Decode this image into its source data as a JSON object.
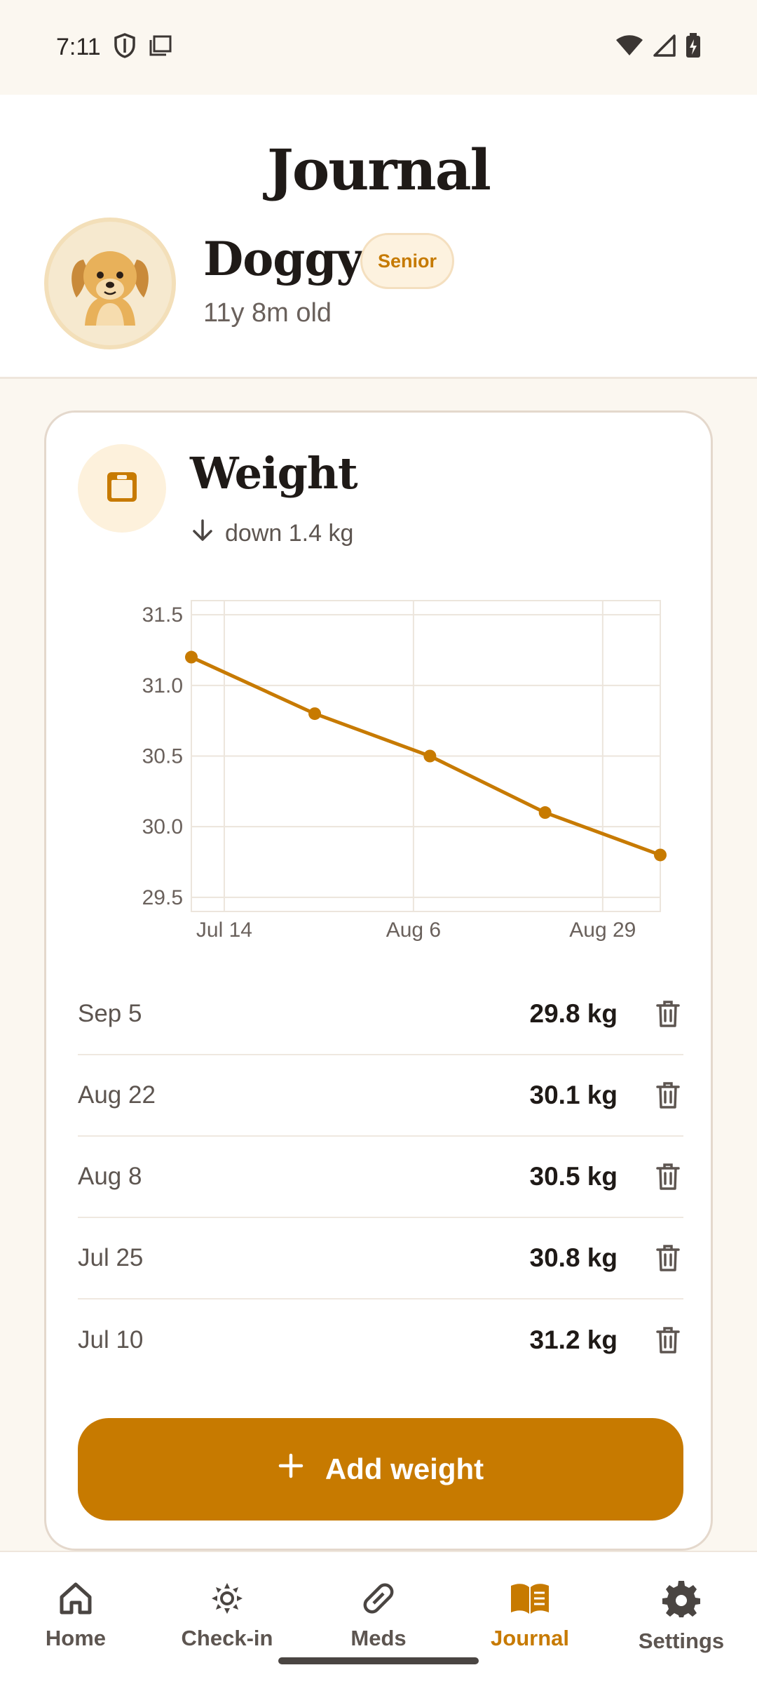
{
  "status_bar": {
    "time": "7:11",
    "icons": [
      "shield-icon",
      "screen-icon",
      "wifi-icon",
      "signal-icon",
      "battery-charging-icon"
    ]
  },
  "header": {
    "title": "Journal",
    "pet": {
      "name": "Doggy",
      "badge": "Senior",
      "age": "11y 8m old",
      "avatar_icon": "dog-avatar-icon"
    }
  },
  "weight_card": {
    "title": "Weight",
    "icon": "scale-icon",
    "trend_icon": "arrow-down-icon",
    "trend_text": "down 1.4 kg",
    "entries": [
      {
        "date": "Sep 5",
        "weight": "29.8 kg"
      },
      {
        "date": "Aug 22",
        "weight": "30.1 kg"
      },
      {
        "date": "Aug 8",
        "weight": "30.5 kg"
      },
      {
        "date": "Jul 25",
        "weight": "30.8 kg"
      },
      {
        "date": "Jul 10",
        "weight": "31.2 kg"
      }
    ],
    "add_button": {
      "label": "Add weight",
      "icon": "plus-icon"
    }
  },
  "chart_data": {
    "type": "line",
    "x": [
      "2024-07-10",
      "2024-07-25",
      "2024-08-08",
      "2024-08-22",
      "2024-09-05"
    ],
    "series": [
      {
        "values": [
          31.2,
          30.8,
          30.5,
          30.1,
          29.8
        ],
        "color": "#c77a00"
      }
    ],
    "x_ticks": [
      "Jul 14",
      "Aug 6",
      "Aug 29"
    ],
    "y_ticks": [
      "31.5",
      "31.0",
      "30.5",
      "30.0",
      "29.5"
    ],
    "ylim": [
      29.4,
      31.6
    ],
    "grid": true
  },
  "bottom_nav": {
    "items": [
      {
        "label": "Home",
        "icon": "home-icon",
        "active": false
      },
      {
        "label": "Check-in",
        "icon": "sun-icon",
        "active": false
      },
      {
        "label": "Meds",
        "icon": "pill-icon",
        "active": false
      },
      {
        "label": "Journal",
        "icon": "book-icon",
        "active": true
      },
      {
        "label": "Settings",
        "icon": "gear-icon",
        "active": false
      }
    ]
  },
  "colors": {
    "accent": "#c77a00",
    "background": "#fbf7f0",
    "badge_bg": "#fdf2df"
  }
}
